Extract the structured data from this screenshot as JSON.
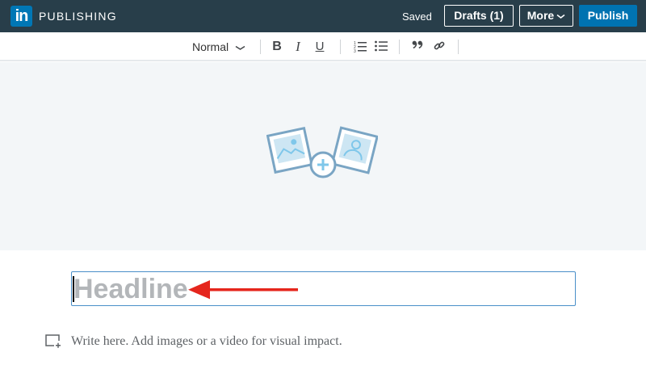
{
  "header": {
    "logo_text": "in",
    "brand": "PUBLISHING",
    "status": "Saved",
    "drafts_label": "Drafts (1)",
    "more_label": "More",
    "publish_label": "Publish"
  },
  "toolbar": {
    "style_select": "Normal",
    "bold": "B",
    "italic": "I",
    "underline": "U",
    "tools": [
      "numbered-list",
      "bulleted-list",
      "quote",
      "link"
    ]
  },
  "editor": {
    "headline_placeholder": "Headline",
    "body_placeholder": "Write here. Add images or a video for visual impact."
  },
  "colors": {
    "topbar": "#283e4a",
    "accent": "#0073b1",
    "arrow": "#e5261d"
  }
}
